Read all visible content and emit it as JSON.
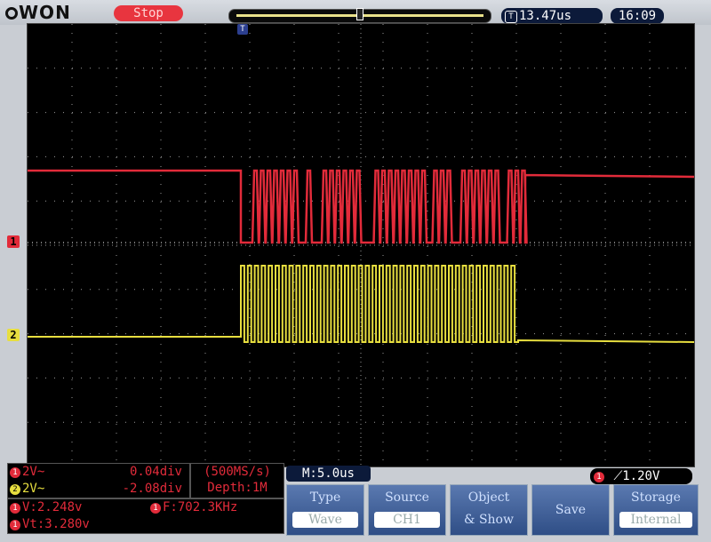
{
  "header": {
    "logo": "WON",
    "run_state": "Stop",
    "trigger_time": "13.47us",
    "trigger_icon": "T",
    "clock": "16:09"
  },
  "screen": {
    "ch1_marker": "1",
    "ch2_marker": "2",
    "trigger_marker": "T",
    "colors": {
      "ch1": "#e22b3a",
      "ch2": "#e7de3f",
      "grid": "#9a9a9a",
      "background": "#000000"
    },
    "ch1_pulses": [
      0.5,
      0.75,
      1,
      1.25,
      1.5,
      1.75,
      2,
      2.5,
      3.1,
      3.35,
      3.6,
      3.85,
      4.1,
      4.35,
      5.05,
      5.3,
      5.55,
      5.8,
      6.05,
      6.3,
      6.55,
      6.8,
      7.25,
      7.5,
      7.75,
      8.3,
      8.55,
      8.8,
      9.05,
      9.3,
      9.55,
      10.05,
      10.3,
      10.55
    ]
  },
  "channels": {
    "ch1": {
      "label": "2V~",
      "value": "0.04div",
      "icon": "1"
    },
    "ch2": {
      "label": "2V~",
      "value": "-2.08div",
      "icon": "2"
    }
  },
  "acquisition": {
    "rate": "(500MS/s)",
    "depth": "Depth:1M"
  },
  "measurements": {
    "v": "V:2.248v",
    "f": "F:702.3KHz",
    "vt": "Vt:3.280v",
    "icon": "1"
  },
  "timebase": "M:5.0us",
  "trigger_level": {
    "icon": "1",
    "value": "1.20V"
  },
  "menu": [
    {
      "title": "Type",
      "value": "Wave"
    },
    {
      "title": "Source",
      "value": "CH1"
    },
    {
      "title": "Object",
      "value": "& Show"
    },
    {
      "title": "Save",
      "value": ""
    },
    {
      "title": "Storage",
      "value": "Internal"
    }
  ]
}
